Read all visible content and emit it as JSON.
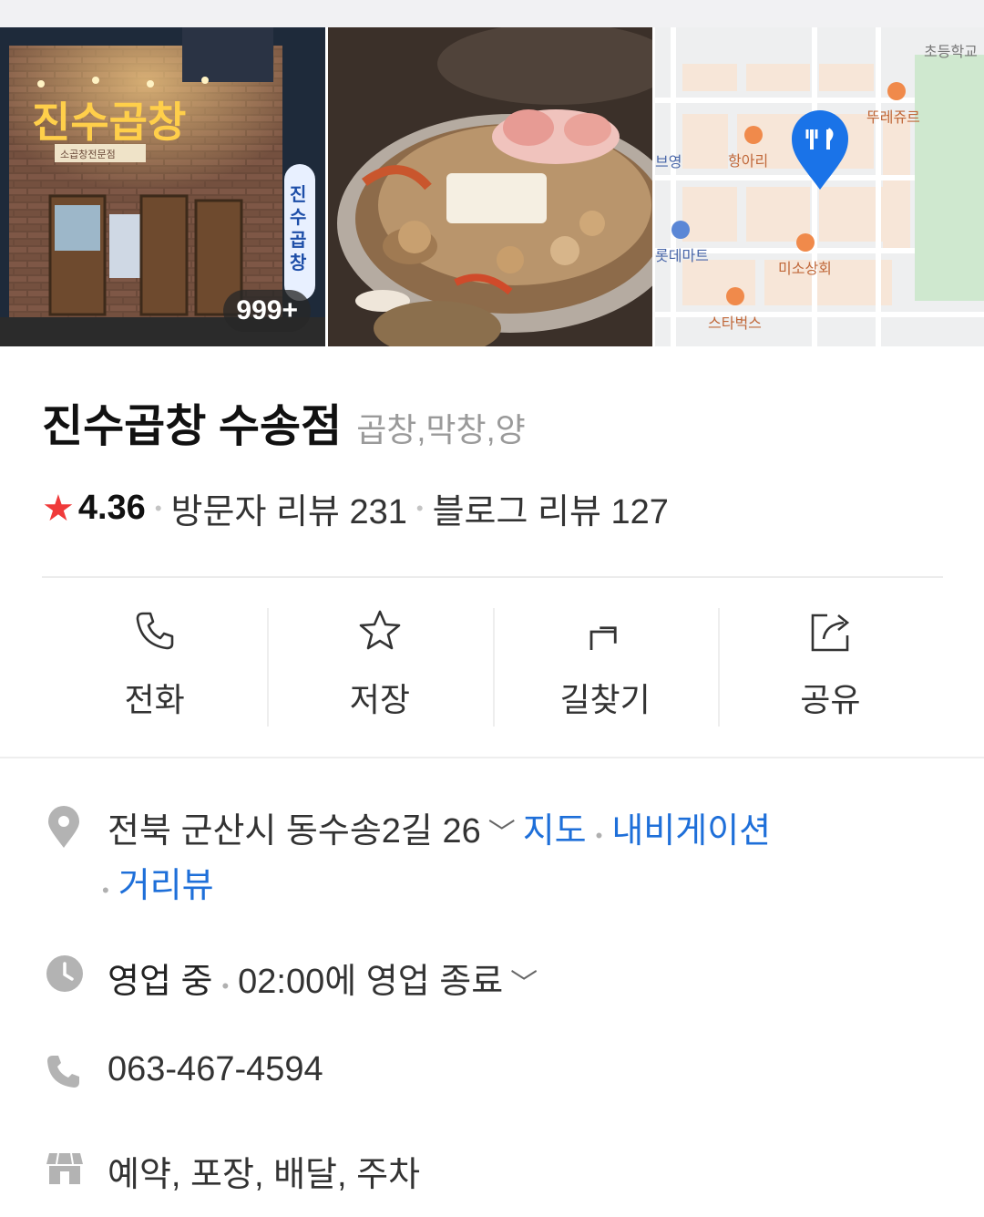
{
  "photos": {
    "count_badge": "999+",
    "storefront_sign": "진수곱창",
    "storefront_subsign": "소곱창전문점",
    "map_labels": [
      "초등학교",
      "뚜레쥬르",
      "항아리",
      "브영",
      "롯데마트",
      "미소상회",
      "스타벅스"
    ]
  },
  "place": {
    "name": "진수곱창 수송점",
    "category": "곱창,막창,양",
    "rating": "4.36",
    "visitor_reviews": "방문자 리뷰 231",
    "blog_reviews": "블로그 리뷰 127"
  },
  "actions": {
    "call": "전화",
    "save": "저장",
    "directions": "길찾기",
    "share": "공유"
  },
  "address": {
    "text": "전북 군산시 동수송2길 26",
    "map_link": "지도",
    "navigation_link": "내비게이션",
    "streetview_link": "거리뷰"
  },
  "hours": {
    "status": "영업 중",
    "closing": "02:00에 영업 종료"
  },
  "phone": "063-467-4594",
  "services": "예약, 포장, 배달, 주차",
  "colors": {
    "accent_blue": "#1e6fd9",
    "rating_star": "#f03a3a",
    "map_pin": "#1a73e8"
  }
}
